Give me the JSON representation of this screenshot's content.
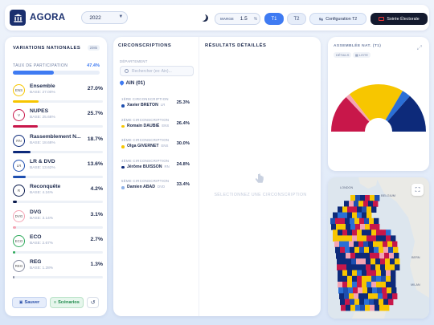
{
  "app": {
    "name": "AGORA"
  },
  "topbar": {
    "year": "2022",
    "marge_label": "MARGE",
    "marge_value": "1.5",
    "marge_unit": "%",
    "t1_label": "T1",
    "t2_label": "T2",
    "config_label": "Configuration T2",
    "soiree_label": "Soirée Électorale"
  },
  "national": {
    "title": "VARIATIONS NATIONALES",
    "badge": "2085",
    "turnout_label": "TAUX DE PARTICIPATION",
    "turnout_value": "47.4%",
    "turnout_fraction": 0.474,
    "parties": [
      {
        "name": "Ensemble",
        "base": "BASE: 27.00%",
        "pct": "27.0%",
        "share": 0.27,
        "color": "#f7c600",
        "icon": "ensemble-logo",
        "abbr": "ENS"
      },
      {
        "name": "NUPES",
        "base": "BASE: 25.66%",
        "pct": "25.7%",
        "share": 0.257,
        "color": "#c8174a",
        "icon": "nupes-logo",
        "abbr": "V"
      },
      {
        "name": "Rassemblement N...",
        "base": "BASE: 18.68%",
        "pct": "18.7%",
        "share": 0.187,
        "color": "#0d2a7a",
        "icon": "rn-logo",
        "abbr": "RN"
      },
      {
        "name": "LR & DVD",
        "base": "BASE: 13.62%",
        "pct": "13.6%",
        "share": 0.136,
        "color": "#1e4fb0",
        "icon": "lr-logo",
        "abbr": "LR"
      },
      {
        "name": "Reconquête",
        "base": "BASE: 4.24%",
        "pct": "4.2%",
        "share": 0.042,
        "color": "#0b1b4d",
        "icon": "reconquete-logo",
        "abbr": "R"
      },
      {
        "name": "DVG",
        "base": "BASE: 3.14%",
        "pct": "3.1%",
        "share": 0.031,
        "color": "#f4a4b4",
        "icon": "dvg-logo",
        "abbr": "DVG"
      },
      {
        "name": "ECO",
        "base": "BASE: 2.67%",
        "pct": "2.7%",
        "share": 0.027,
        "color": "#2faa5c",
        "icon": "eco-logo",
        "abbr": "ECO"
      },
      {
        "name": "REG",
        "base": "BASE: 1.28%",
        "pct": "1.3%",
        "share": 0.013,
        "color": "#8a8fa3",
        "icon": "reg-logo",
        "abbr": "REG"
      }
    ],
    "save_label": "Sauver",
    "scenarios_label": "Scénarios"
  },
  "circonscriptions": {
    "title": "CIRCONSCRIPTIONS",
    "dept_label": "DÉPARTEMENT",
    "search_placeholder": "Rechercher (ex: Ain)...",
    "dept_name": "AIN (01)",
    "items": [
      {
        "label": "1ÈRE CIRCONSCRIPTION",
        "name": "Xavier BRETON",
        "party": "LR",
        "pct": "25.3%",
        "color": "#1e4fb0"
      },
      {
        "label": "2ÈME CIRCONSCRIPTION",
        "name": "Romain DAUBIÉ",
        "party": "ENS",
        "pct": "26.4%",
        "color": "#f7c600"
      },
      {
        "label": "3ÈME CIRCONSCRIPTION",
        "name": "Olga GIVERNET",
        "party": "ENS",
        "pct": "30.0%",
        "color": "#f7c600"
      },
      {
        "label": "4ÈME CIRCONSCRIPTION",
        "name": "Jérôme BUISSON",
        "party": "RN",
        "pct": "24.8%",
        "color": "#0d2a7a"
      },
      {
        "label": "5ÈME CIRCONSCRIPTION",
        "name": "Damien ABAD",
        "party": "DVD",
        "pct": "33.4%",
        "color": "#8fb2e8"
      }
    ]
  },
  "details": {
    "title": "RÉSULTATS DÉTAILLÉS",
    "empty": "SÉLECTIONNEZ UNE CIRCONSCRIPTION"
  },
  "assembly": {
    "title": "ASSEMBLÉE NAT. (T1)",
    "tab_details": "DÉTAILS",
    "tab_list": "LISTE",
    "seats": [
      {
        "party": "NUPES",
        "share": 0.26,
        "color": "#c8174a"
      },
      {
        "party": "DVG",
        "share": 0.03,
        "color": "#f4a4b4"
      },
      {
        "party": "Ensemble",
        "share": 0.38,
        "color": "#f7c600"
      },
      {
        "party": "LR & DVD",
        "share": 0.06,
        "color": "#2a6fd6"
      },
      {
        "party": "Rassemblement National",
        "share": 0.27,
        "color": "#0d2a7a"
      }
    ]
  },
  "map": {
    "labels": [
      "LONDON",
      "BELGIUM",
      "BERN",
      "MILAN"
    ]
  }
}
